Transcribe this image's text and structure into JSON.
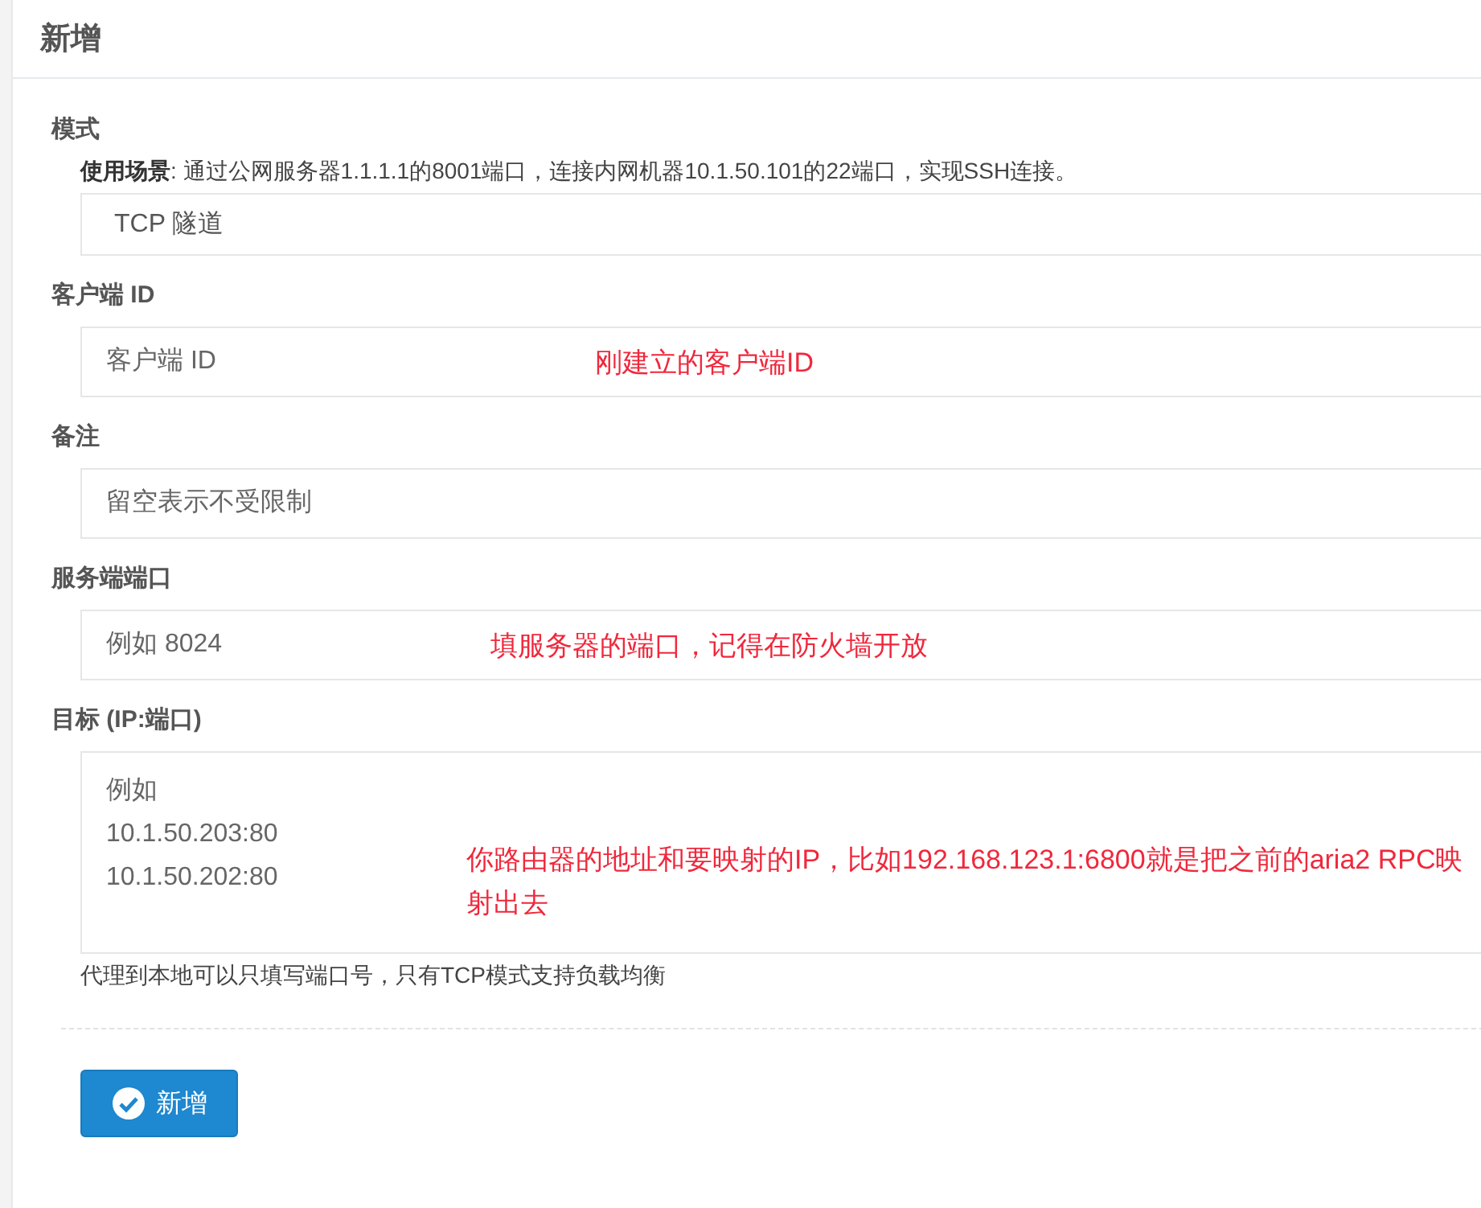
{
  "panel": {
    "title": "新增"
  },
  "fields": [
    {
      "kind": "select",
      "label": "模式",
      "hint": "**使用场景**: 通过公网服务器1.1.1.1的8001端口，连接内网机器10.1.50.101的22端口，实现SSH连接。",
      "value": "TCP 隧道"
    },
    {
      "kind": "input",
      "label": "客户端 ID",
      "placeholder": "客户端 ID",
      "annotation": "刚建立的客户端ID"
    },
    {
      "kind": "input",
      "label": "备注",
      "placeholder": "留空表示不受限制"
    },
    {
      "kind": "input",
      "label": "服务端端口",
      "placeholder": "例如 8024",
      "annotation": "填服务器的端口，记得在防火墙开放"
    },
    {
      "kind": "textarea",
      "label": "目标 (IP:端口)",
      "placeholder": "例如\n10.1.50.203:80\n10.1.50.202:80",
      "annotation": "你路由器的地址和要映射的IP，比如192.168.123.1:6800就是把之前的aria2 RPC映射出去",
      "help": "代理到本地可以只填写端口号，只有TCP模式支持负载均衡"
    }
  ],
  "submit": {
    "label": "新增"
  }
}
